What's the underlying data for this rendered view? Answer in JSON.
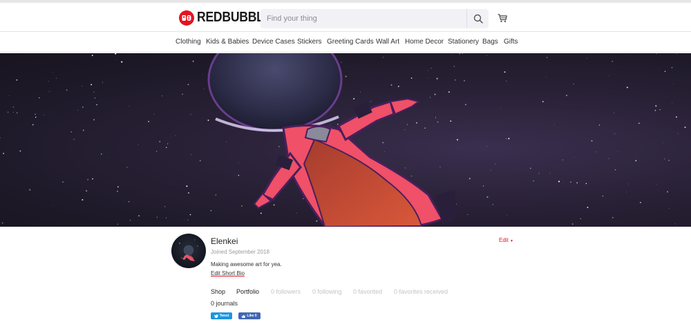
{
  "header": {
    "brand": "REDBUBBLE",
    "search_placeholder": "Find your thing",
    "accent": "#e41321"
  },
  "nav": {
    "items": [
      {
        "label": "Clothing"
      },
      {
        "label": "Kids & Babies"
      },
      {
        "label": "Device Cases"
      },
      {
        "label": "Stickers"
      },
      {
        "label": "Greeting Cards"
      },
      {
        "label": "Wall Art"
      },
      {
        "label": "Home Decor"
      },
      {
        "label": "Stationery"
      },
      {
        "label": "Bags"
      },
      {
        "label": "Gifts"
      }
    ]
  },
  "profile": {
    "username": "Elenkei",
    "joined": "Joined September 2018",
    "bio": "Making awesome art for yea.",
    "edit_bio_label": "Edit Short Bio",
    "edit_label": "Edit",
    "tabs": [
      {
        "label": "Shop"
      },
      {
        "label": "Portfolio"
      },
      {
        "label": "0 followers"
      },
      {
        "label": "0 following"
      },
      {
        "label": "0 favorited"
      },
      {
        "label": "0 favorites received"
      }
    ],
    "journals": "0 journals"
  },
  "social": {
    "tweet_label": "Tweet",
    "like_label": "Like 0",
    "twitter_color": "#1b95e0",
    "facebook_color": "#4267b2"
  }
}
